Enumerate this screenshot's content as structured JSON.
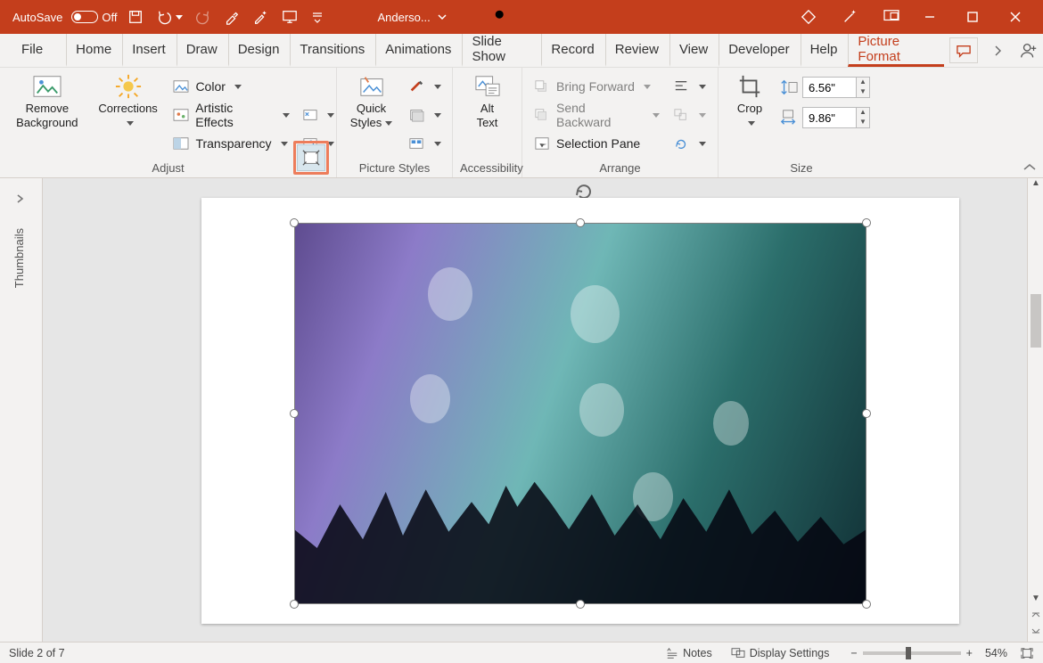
{
  "titlebar": {
    "autosave_label": "AutoSave",
    "autosave_state": "Off",
    "doc_name": "Anderso..."
  },
  "tabs": {
    "file": "File",
    "home": "Home",
    "insert": "Insert",
    "draw": "Draw",
    "design": "Design",
    "transitions": "Transitions",
    "animations": "Animations",
    "slideshow": "Slide Show",
    "record": "Record",
    "review": "Review",
    "view": "View",
    "developer": "Developer",
    "help": "Help",
    "picture_format": "Picture Format"
  },
  "ribbon": {
    "adjust": {
      "remove_bg_line1": "Remove",
      "remove_bg_line2": "Background",
      "corrections": "Corrections",
      "color": "Color",
      "artistic": "Artistic Effects",
      "transparency": "Transparency",
      "group_label": "Adjust"
    },
    "picture_styles": {
      "quick_line1": "Quick",
      "quick_line2": "Styles",
      "group_label": "Picture Styles"
    },
    "accessibility": {
      "alt_line1": "Alt",
      "alt_line2": "Text",
      "group_label": "Accessibility"
    },
    "arrange": {
      "bring_forward": "Bring Forward",
      "send_backward": "Send Backward",
      "selection_pane": "Selection Pane",
      "group_label": "Arrange"
    },
    "size": {
      "crop": "Crop",
      "height": "6.56\"",
      "width": "9.86\"",
      "group_label": "Size"
    }
  },
  "thumbnails_label": "Thumbnails",
  "statusbar": {
    "slide": "Slide 2 of 7",
    "notes": "Notes",
    "display": "Display Settings",
    "zoom": "54%"
  }
}
